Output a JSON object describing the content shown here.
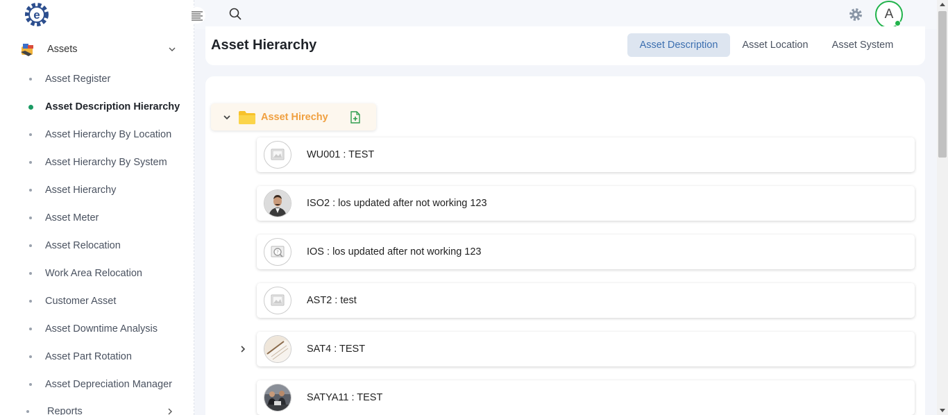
{
  "sidebar": {
    "group_label": "Assets",
    "items": [
      {
        "label": "Asset Register",
        "active": false
      },
      {
        "label": "Asset Description Hierarchy",
        "active": true
      },
      {
        "label": "Asset Hierarchy By Location",
        "active": false
      },
      {
        "label": "Asset Hierarchy By System",
        "active": false
      },
      {
        "label": "Asset Hierarchy",
        "active": false
      },
      {
        "label": "Asset Meter",
        "active": false
      },
      {
        "label": "Asset Relocation",
        "active": false
      },
      {
        "label": "Work Area Relocation",
        "active": false
      },
      {
        "label": "Customer Asset",
        "active": false
      },
      {
        "label": "Asset Downtime Analysis",
        "active": false
      },
      {
        "label": "Asset Part Rotation",
        "active": false
      },
      {
        "label": "Asset Depreciation Manager",
        "active": false
      }
    ],
    "reports_label": "Reports"
  },
  "topbar": {
    "avatar_initial": "A"
  },
  "header": {
    "title": "Asset Hierarchy",
    "tabs": [
      {
        "label": "Asset Description",
        "active": true
      },
      {
        "label": "Asset Location",
        "active": false
      },
      {
        "label": "Asset System",
        "active": false
      }
    ]
  },
  "tree": {
    "root_label": "Asset Hirechy",
    "assets": [
      {
        "label": "WU001 : TEST",
        "image": "placeholder"
      },
      {
        "label": "ISO2 : los updated after not working 123",
        "image": "person-photo"
      },
      {
        "label": "IOS : los updated after not working 123",
        "image": "search-placeholder"
      },
      {
        "label": "AST2 : test",
        "image": "placeholder"
      },
      {
        "label": "SAT4 : TEST",
        "image": "paper-photo",
        "expandable": true
      },
      {
        "label": "SATYA11 : TEST",
        "image": "group-photo"
      }
    ]
  },
  "colors": {
    "accent_green": "#1a9a63",
    "active_tab_bg": "#dde5f0",
    "active_tab_text": "#3c6fb0",
    "root_label": "#f0a040",
    "avatar_ring": "#21b34b"
  }
}
